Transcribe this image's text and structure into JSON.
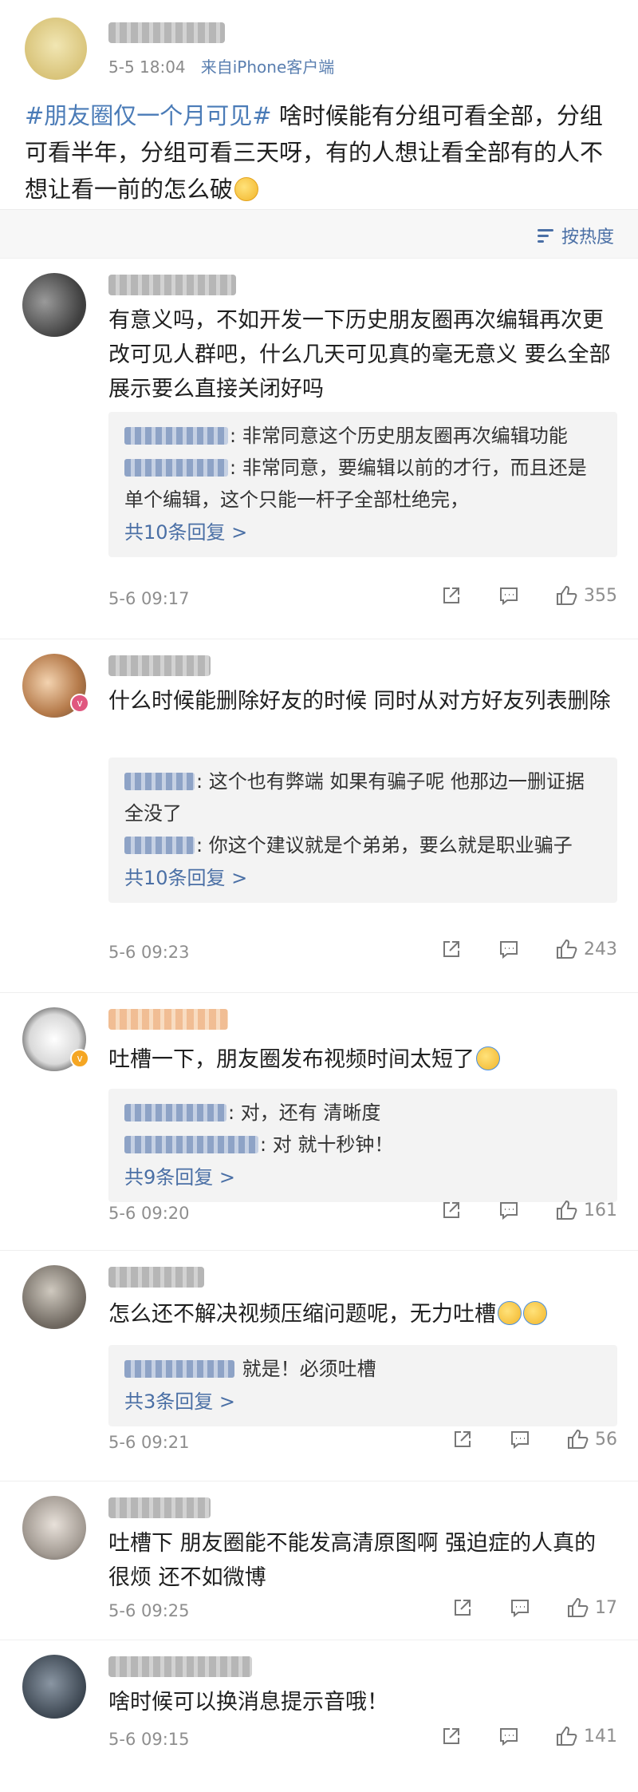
{
  "post": {
    "time": "5-5 18:04",
    "source": "来自iPhone客户端",
    "hashtag": "#朋友圈仅一个月可见#",
    "text": " 啥时候能有分组可看全部，分组可看半年，分组可看三天呀，有的人想让看全部有的人不想让看一前的怎么破"
  },
  "sort": {
    "label": "按热度"
  },
  "comments": [
    {
      "text": "有意义吗，不如开发一下历史朋友圈再次编辑再次更改可见人群吧，什么几天可见真的毫无意义 要么全部展示要么直接关闭好吗",
      "replies": [
        {
          "text": ": 非常同意这个历史朋友圈再次编辑功能"
        },
        {
          "text": ": 非常同意，要编辑以前的才行，而且还是单个编辑，这个只能一杆子全部杜绝完，"
        }
      ],
      "more": "共10条回复 >",
      "time": "5-6 09:17",
      "likes": "355"
    },
    {
      "text": "什么时候能删除好友的时候 同时从对方好友列表删除",
      "replies": [
        {
          "text": ": 这个也有弊端 如果有骗子呢 他那边一删证据全没了"
        },
        {
          "text": ": 你这个建议就是个弟弟，要么就是职业骗子"
        }
      ],
      "more": "共10条回复 >",
      "time": "5-6 09:23",
      "likes": "243"
    },
    {
      "text": "吐槽一下，朋友圈发布视频时间太短了",
      "replies": [
        {
          "text": ": 对，还有 清晰度"
        },
        {
          "text": ": 对 就十秒钟！"
        }
      ],
      "more": "共9条回复 >",
      "time": "5-6 09:20",
      "likes": "161"
    },
    {
      "text": "怎么还不解决视频压缩问题呢，无力吐槽",
      "replies": [
        {
          "text": " 就是！必须吐槽"
        }
      ],
      "more": "共3条回复 >",
      "time": "5-6 09:21",
      "likes": "56"
    },
    {
      "text": "吐槽下 朋友圈能不能发高清原图啊 强迫症的人真的很烦 还不如微博",
      "time": "5-6 09:25",
      "likes": "17"
    },
    {
      "text": "啥时候可以换消息提示音哦！",
      "time": "5-6 09:15",
      "likes": "141"
    }
  ],
  "colors": {
    "link": "#4a6fa5",
    "hashtag": "#4a7bb7",
    "verified": "#f5a623",
    "vip": "#e0577f"
  }
}
